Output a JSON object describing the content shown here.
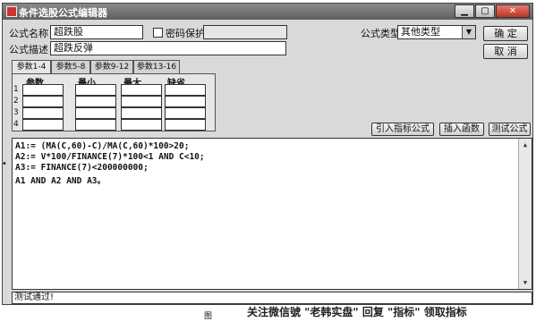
{
  "window": {
    "title": "条件选股公式编辑器",
    "min_glyph": "▁",
    "max_glyph": "▢",
    "close_glyph": "✕"
  },
  "form": {
    "name_label": "公式名称",
    "name_value": "超跌股",
    "password_label": "密码保护",
    "password_checked": false,
    "password_value": "",
    "desc_label": "公式描述",
    "desc_value": "超跌反弹",
    "type_label": "公式类型",
    "type_value": "其他类型"
  },
  "buttons": {
    "ok": "确 定",
    "cancel": "取 消",
    "import_indicator": "引入指标公式",
    "insert_function": "插入函数",
    "test_formula": "测试公式"
  },
  "tabs": [
    "参数1-4",
    "参数5-8",
    "参数9-12",
    "参数13-16"
  ],
  "params": {
    "headers": [
      "参数",
      "最小",
      "最大",
      "缺省"
    ],
    "rows": [
      "1",
      "2",
      "3",
      "4"
    ]
  },
  "code": [
    "A1:= (MA(C,60)-C)/MA(C,60)*100>20;",
    "A2:= V*100/FINANCE(7)*100<1 AND C<10;",
    "A3:= FINANCE(7)<200000000;",
    "A1 AND A2 AND A3。"
  ],
  "status": "测试通过!",
  "watermark": "关注微信號 \"老韩实盘\" 回复 \"指标\" 领取指标",
  "background_marks": {
    "bullet": "•",
    "fig_label": "图"
  }
}
